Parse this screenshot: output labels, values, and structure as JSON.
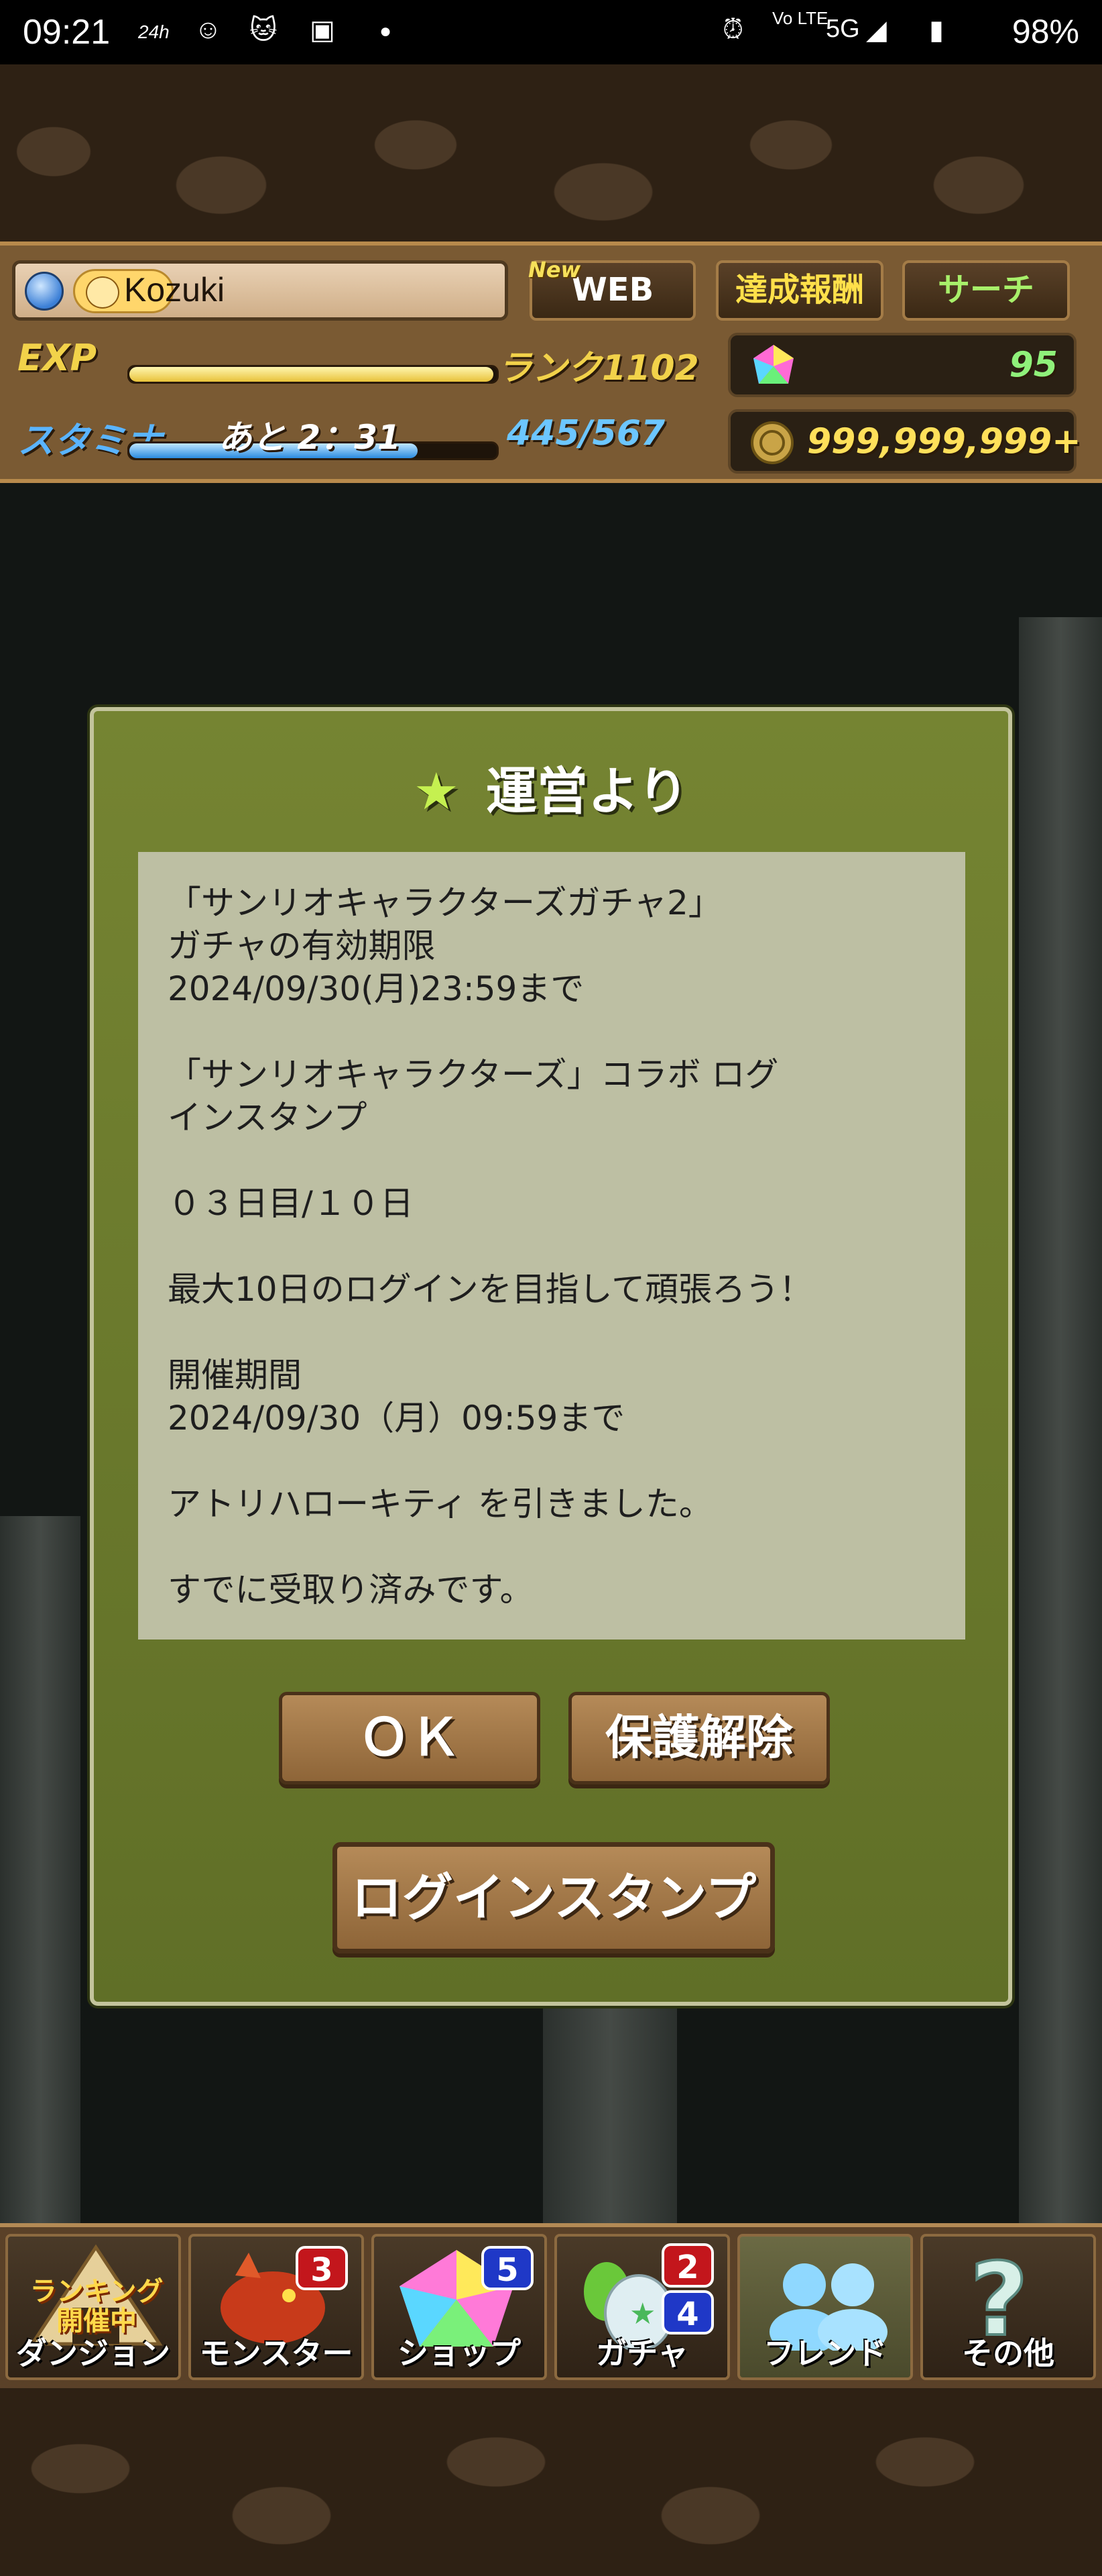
{
  "status_bar": {
    "time": "09:21",
    "icons_left": [
      "24h-icon",
      "smiley-icon",
      "cat-icon",
      "twitch-icon",
      "dot-icon"
    ],
    "network": "5G",
    "volte": "Vo LTE",
    "battery": "98%"
  },
  "header": {
    "player_name": "Kozuki",
    "web_button": "WEB",
    "new_tag": "New",
    "achievements_button": "達成報酬",
    "search_button": "サーチ",
    "exp_label": "EXP",
    "exp_fill": 0.99,
    "rank_text": "ランク1102",
    "stamina_label": "スタミナ",
    "stamina_timer": "あと 2：31",
    "stamina_value": "445/567",
    "stamina_fill": 0.785,
    "magic_stones": "95",
    "coins": "999,999,999+"
  },
  "dialog": {
    "title": "運営より",
    "message_lines": [
      "「サンリオキャラクターズガチャ2」",
      "ガチャの有効期限",
      "2024/09/30(月)23:59まで",
      "",
      "「サンリオキャラクターズ」コラボ ログ",
      "インスタンプ",
      "",
      "０３日目/１０日",
      "",
      "最大10日のログインを目指して頑張ろう！",
      "",
      "開催期間",
      "2024/09/30（月）09:59まで",
      "",
      "アトリハローキティ を引きました。",
      "",
      "すでに受取り済みです。"
    ],
    "ok_button": "ＯＫ",
    "unprotect_button": "保護解除",
    "login_stamp_button": "ログインスタンプ"
  },
  "nav": {
    "items": [
      {
        "label": "ダンジョン",
        "sub": "ランキング開催中"
      },
      {
        "label": "モンスター",
        "badge": "3"
      },
      {
        "label": "ショップ",
        "badge": "5"
      },
      {
        "label": "ガチャ",
        "badge": "2",
        "badge2": "4"
      },
      {
        "label": "フレンド"
      },
      {
        "label": "その他"
      }
    ]
  }
}
